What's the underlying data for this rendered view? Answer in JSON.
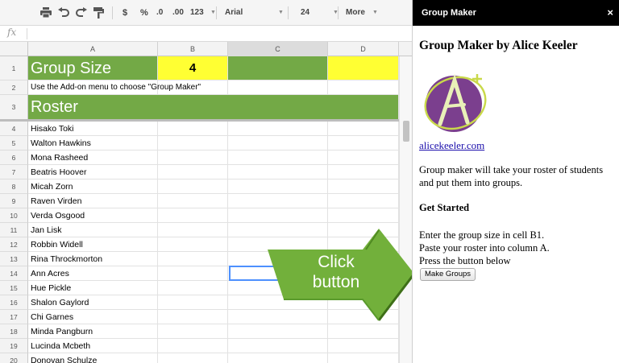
{
  "toolbar": {
    "zoom_label": "123",
    "currency_label": "$",
    "percent_label": "%",
    "dec_decrease_label": ".0",
    "dec_increase_label": ".00",
    "font_family": "Arial",
    "font_size": "24",
    "more_label": "More"
  },
  "formula_bar": {
    "fx_label": "fx"
  },
  "columns": [
    "A",
    "B",
    "C",
    "D"
  ],
  "rows": {
    "r1": {
      "num": "1",
      "a": "Group Size",
      "b": "4"
    },
    "r2": {
      "num": "2",
      "a": "Use the Add-on menu to choose \"Group Maker\""
    },
    "r3": {
      "num": "3",
      "a": "Roster"
    },
    "names": [
      {
        "num": "4",
        "name": "Hisako Toki"
      },
      {
        "num": "5",
        "name": "Walton Hawkins"
      },
      {
        "num": "6",
        "name": "Mona Rasheed"
      },
      {
        "num": "7",
        "name": "Beatris Hoover"
      },
      {
        "num": "8",
        "name": "Micah Zorn"
      },
      {
        "num": "9",
        "name": "Raven Virden"
      },
      {
        "num": "10",
        "name": "Verda Osgood"
      },
      {
        "num": "11",
        "name": "Jan Lisk"
      },
      {
        "num": "12",
        "name": "Robbin Widell"
      },
      {
        "num": "13",
        "name": "Rina Throckmorton"
      },
      {
        "num": "14",
        "name": "Ann Acres"
      },
      {
        "num": "15",
        "name": "Hue Pickle"
      },
      {
        "num": "16",
        "name": "Shalon Gaylord"
      },
      {
        "num": "17",
        "name": "Chi Garnes"
      },
      {
        "num": "18",
        "name": "Minda Pangburn"
      },
      {
        "num": "19",
        "name": "Lucinda Mcbeth"
      },
      {
        "num": "20",
        "name": "Donovan Schulze"
      }
    ]
  },
  "callout": {
    "line1": "Click",
    "line2": "button"
  },
  "sidebar": {
    "title": "Group Maker",
    "close_icon": "×",
    "heading": "Group Maker by Alice Keeler",
    "link": "alicekeeler.com",
    "description": "Group maker will take your roster of students and put them into groups.",
    "get_started": "Get Started",
    "step1": "Enter the group size in cell B1.",
    "step2": "Paste your roster into column A.",
    "step3": "Press the button below",
    "button": "Make Groups"
  },
  "colors": {
    "header_green": "#73a946",
    "yellow": "#ffff33",
    "arrow_green": "#72b03b",
    "selection_blue": "#4d90fe",
    "logo_purple": "#7b3f8e"
  }
}
